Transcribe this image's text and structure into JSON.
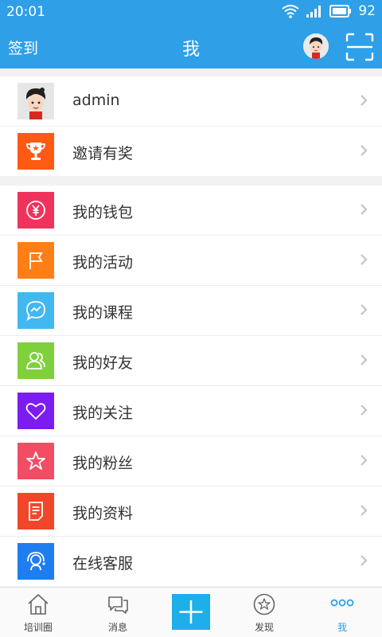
{
  "status": {
    "time": "20:01",
    "battery": "92"
  },
  "header": {
    "left_label": "签到",
    "title": "我"
  },
  "profile": {
    "name": "admin",
    "invite": "邀请有奖"
  },
  "menu": [
    {
      "label": "我的钱包",
      "color": "#f0335c",
      "icon": "wallet-icon"
    },
    {
      "label": "我的活动",
      "color": "#ff7f16",
      "icon": "flag-icon"
    },
    {
      "label": "我的课程",
      "color": "#42b8f0",
      "icon": "chat-bubble-icon"
    },
    {
      "label": "我的好友",
      "color": "#80d03d",
      "icon": "friends-icon"
    },
    {
      "label": "我的关注",
      "color": "#7c1cf0",
      "icon": "heart-icon"
    },
    {
      "label": "我的粉丝",
      "color": "#f24d64",
      "icon": "star-icon"
    },
    {
      "label": "我的资料",
      "color": "#f2462a",
      "icon": "document-icon"
    },
    {
      "label": "在线客服",
      "color": "#1e7ef0",
      "icon": "headset-icon"
    }
  ],
  "invite_color": "#ff5a14",
  "tabs": {
    "training": "培训圈",
    "messages": "消息",
    "discover": "发现",
    "me": "我"
  }
}
